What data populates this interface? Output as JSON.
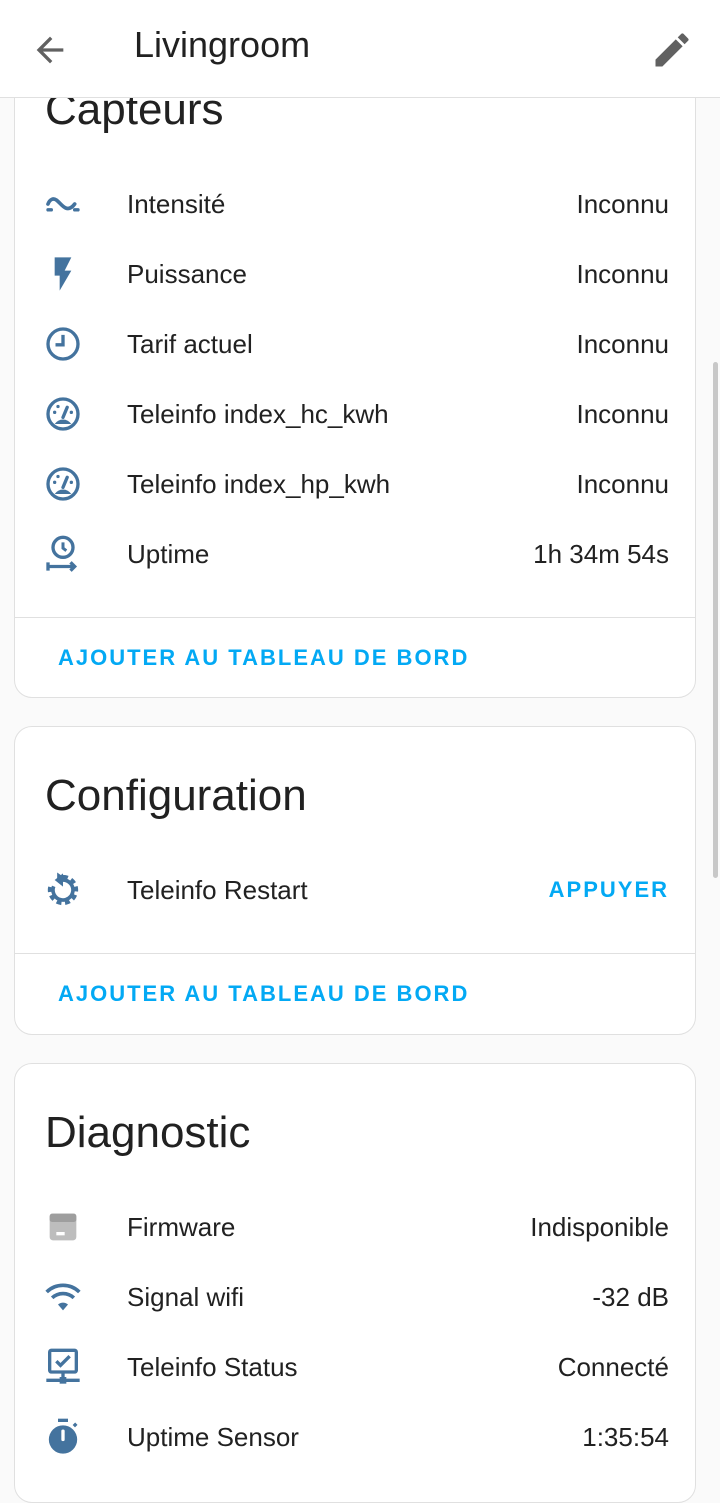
{
  "header": {
    "title": "Livingroom",
    "back_icon": "arrow-left-icon",
    "edit_icon": "pencil-icon"
  },
  "colors": {
    "accent": "#03a9f4",
    "icon": "#44739e",
    "icon_disabled": "#bdbdbd"
  },
  "capteurs": {
    "title": "Capteurs",
    "rows": [
      {
        "label": "Intensité",
        "value": "Inconnu",
        "icon": "current-ac-icon"
      },
      {
        "label": "Puissance",
        "value": "Inconnu",
        "icon": "flash-icon"
      },
      {
        "label": "Tarif actuel",
        "value": "Inconnu",
        "icon": "clock-icon"
      },
      {
        "label": "Teleinfo index_hc_kwh",
        "value": "Inconnu",
        "icon": "gauge-icon"
      },
      {
        "label": "Teleinfo index_hp_kwh",
        "value": "Inconnu",
        "icon": "gauge-icon"
      },
      {
        "label": "Uptime",
        "value": "1h 34m 54s",
        "icon": "timer-arrow-icon"
      }
    ],
    "action": "AJOUTER AU TABLEAU DE BORD"
  },
  "configuration": {
    "title": "Configuration",
    "rows": [
      {
        "label": "Teleinfo Restart",
        "action": "APPUYER",
        "icon": "restart-icon"
      }
    ],
    "action": "AJOUTER AU TABLEAU DE BORD"
  },
  "diagnostic": {
    "title": "Diagnostic",
    "rows": [
      {
        "label": "Firmware",
        "value": "Indisponible",
        "icon": "package-icon"
      },
      {
        "label": "Signal wifi",
        "value": "-32 dB",
        "icon": "wifi-icon"
      },
      {
        "label": "Teleinfo Status",
        "value": "Connecté",
        "icon": "monitor-check-icon"
      },
      {
        "label": "Uptime Sensor",
        "value": "1:35:54",
        "icon": "stopwatch-icon"
      }
    ]
  }
}
